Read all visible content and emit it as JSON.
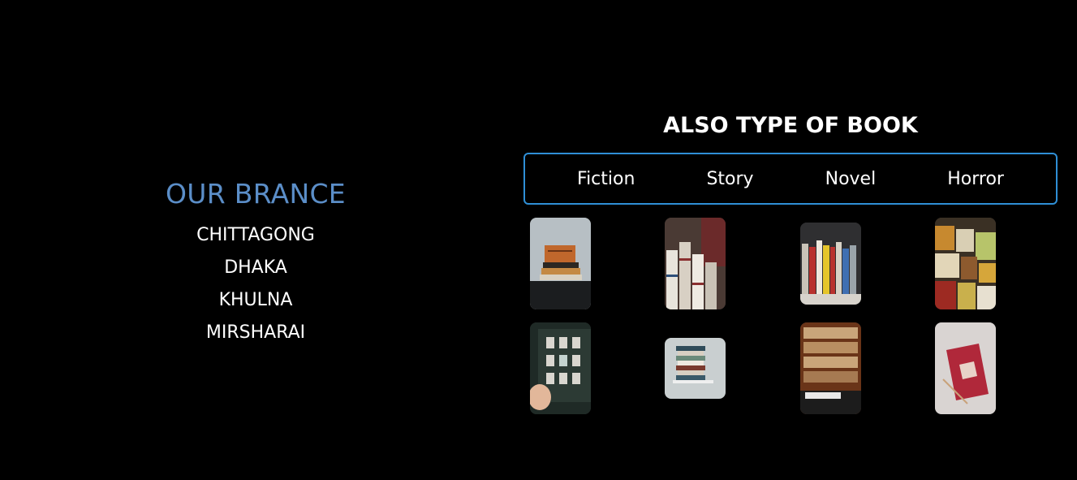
{
  "branches": {
    "title": "OUR BRANCE",
    "items": [
      "CHITTAGONG",
      "DHAKA",
      "KHULNA",
      "MIRSHARAI"
    ]
  },
  "books": {
    "title": "ALSO TYPE OF BOOK",
    "tabs": [
      "Fiction",
      "Story",
      "Novel",
      "Horror"
    ]
  },
  "colors": {
    "background": "#000000",
    "branch_title": "#5b8ec8",
    "tab_border": "#2f8fd6"
  }
}
